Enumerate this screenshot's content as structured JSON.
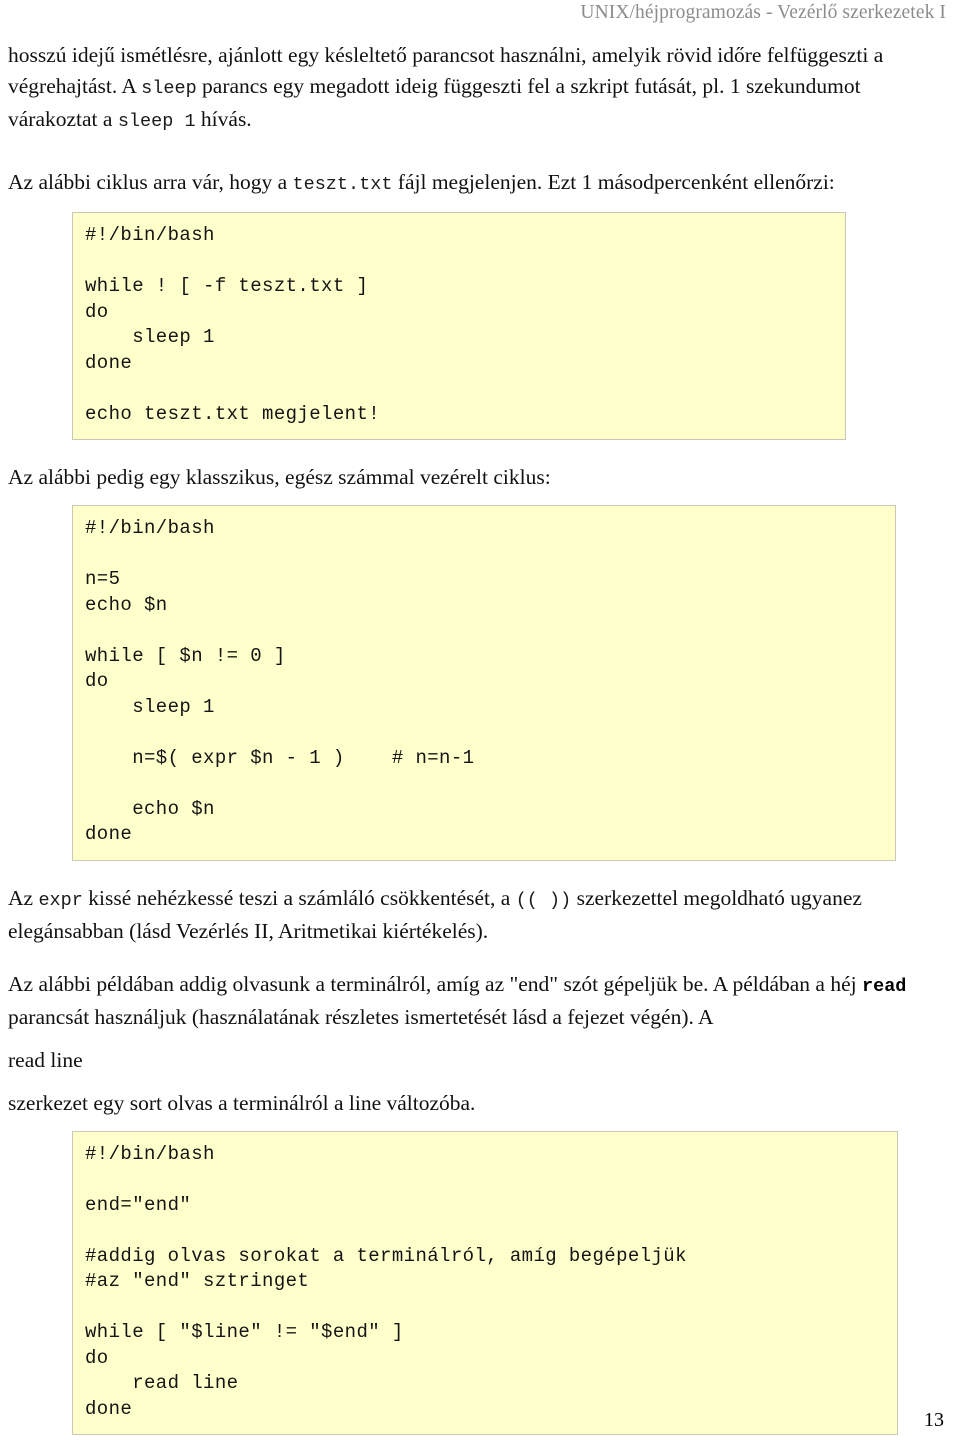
{
  "header": {
    "running_title": "UNIX/héjprogramozás - Vezérlő szerkezetek I"
  },
  "footer": {
    "page_number": "13"
  },
  "colors": {
    "code_background": "#ffffcc",
    "code_border": "#c8c8b4",
    "header_text": "#8c8c8c",
    "body_text": "#111111",
    "page_background": "#ffffff"
  },
  "body": {
    "paragraph_1": {
      "part_1": "hosszú idejű ismétlésre, ajánlott egy késleltető parancsot használni, amelyik rövid időre felfüggeszti a végrehajtást. A ",
      "code_1": "sleep",
      "part_2": " parancs  egy megadott ideig függeszti fel a szkript futását, pl. 1 szekundumot várakoztat a ",
      "code_2": "sleep 1",
      "part_3": " hívás."
    },
    "paragraph_2": {
      "part_1": "Az alábbi ciklus arra vár, hogy a ",
      "code_1": "teszt.txt",
      "part_2": " fájl megjelenjen. Ezt 1 másodpercenként ellenőrzi:"
    },
    "paragraph_3": {
      "text": "Az alábbi pedig egy klasszikus, egész számmal vezérelt ciklus:"
    },
    "paragraph_4": {
      "part_1": "Az ",
      "code_1": "expr",
      "part_2": " kissé nehézkessé teszi a számláló csökkentését, a ",
      "code_2": "(( ))",
      "part_3": " szerkezettel megoldható ugyanez elegánsabban (lásd Vezérlés II, Aritmetikai kiértékelés)."
    },
    "paragraph_5": {
      "part_1": "Az alábbi példában addig olvasunk a terminálról, amíg az \"end\" szót gépeljük be. A példában a héj ",
      "code_1": "read",
      "part_2": "  parancsát használjuk (használatának részletes ismertetését lásd a fejezet végén). A"
    },
    "paragraph_6": {
      "text": "read line"
    },
    "paragraph_7": {
      "text": "szerkezet  egy sort olvas a terminálról a line változóba."
    }
  },
  "code_blocks": [
    {
      "id": "code-block-wait-for-file",
      "language": "bash",
      "lines": [
        "#!/bin/bash",
        "",
        "while ! [ -f teszt.txt ]",
        "do",
        "    sleep 1",
        "done",
        "",
        "echo teszt.txt megjelent!"
      ]
    },
    {
      "id": "code-block-counter-loop",
      "language": "bash",
      "lines": [
        "#!/bin/bash",
        "",
        "n=5",
        "echo $n",
        "",
        "while [ $n != 0 ]",
        "do",
        "    sleep 1",
        "",
        "    n=$( expr $n - 1 )    # n=n-1",
        "",
        "    echo $n",
        "done"
      ]
    },
    {
      "id": "code-block-read-until-end",
      "language": "bash",
      "lines": [
        "#!/bin/bash",
        "",
        "end=\"end\"",
        "",
        "#addig olvas sorokat a terminálról, amíg begépeljük",
        "#az \"end\" sztringet",
        "",
        "while [ \"$line\" != \"$end\" ]",
        "do",
        "    read line",
        "done"
      ]
    }
  ]
}
